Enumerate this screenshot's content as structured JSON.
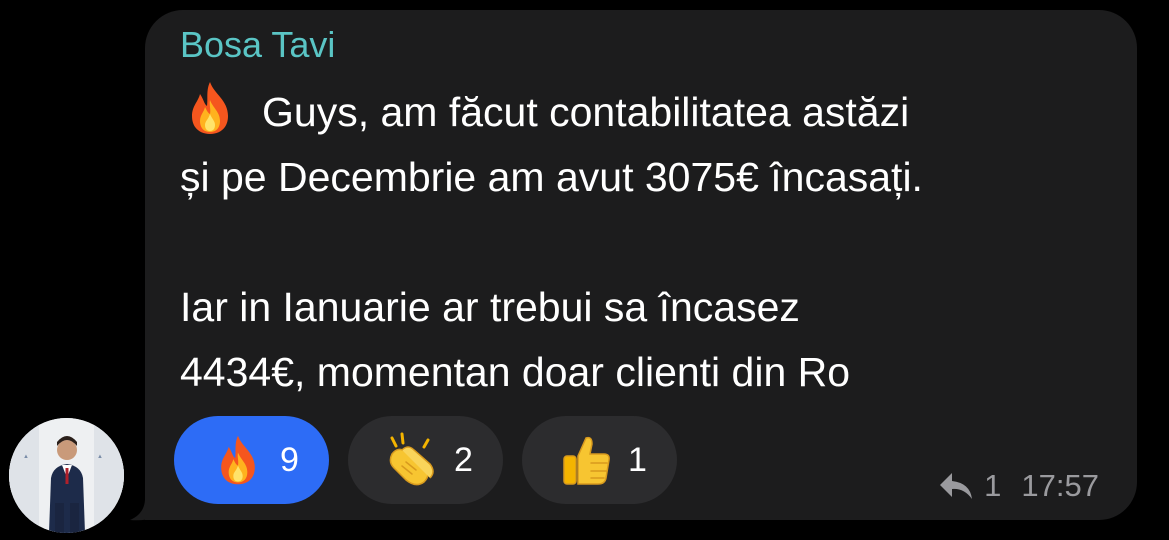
{
  "message": {
    "sender": "Bosa Tavi",
    "lead_emoji": "fire-icon",
    "text": "Guys, am făcut contabilitatea astăzi\nși pe Decembrie am avut 3075€ încasați.\n\nIar in Ianuarie ar trebui sa încasez\n4434€, momentan doar clienti din Ro",
    "reply_count": "1",
    "time": "17:57"
  },
  "reactions": [
    {
      "icon": "fire-icon",
      "count": "9",
      "selected": true
    },
    {
      "icon": "clapping-hands-icon",
      "count": "2",
      "selected": false
    },
    {
      "icon": "thumbs-up-icon",
      "count": "1",
      "selected": false
    }
  ],
  "colors": {
    "background": "#000000",
    "bubble": "#1c1c1d",
    "sender_name": "#5ac5c5",
    "reaction_selected": "#2d6cf6",
    "reaction_default": "#2c2c2e",
    "meta_text": "#9a9a9e"
  }
}
